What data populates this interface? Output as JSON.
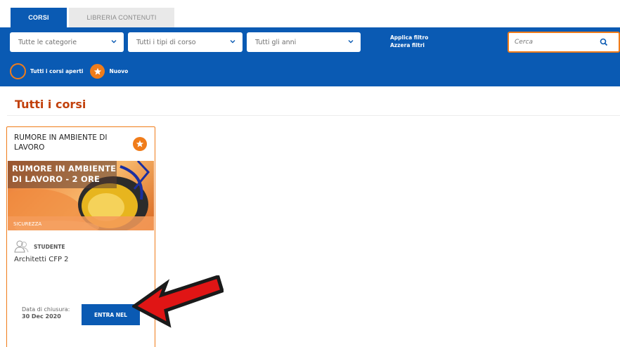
{
  "tabs": [
    {
      "label": "CORSI",
      "active": true
    },
    {
      "label": "LIBRERIA CONTENUTI",
      "active": false
    }
  ],
  "filters": {
    "category": "Tutte le categorie",
    "type": "Tutti i tipi di corso",
    "year": "Tutti gli anni",
    "apply_label": "Applica filtro",
    "reset_label": "Azzera filtri",
    "search_placeholder": "Cerca",
    "search_value": ""
  },
  "legend": {
    "open_courses": "Tutti i corsi aperti",
    "new": "Nuovo"
  },
  "page_title": "Tutti i corsi",
  "course_card": {
    "title": "RUMORE IN AMBIENTE DI LAVORO",
    "image_caption_line1": "RUMORE IN AMBIENTE",
    "image_caption_line2": "DI LAVORO - 2 ORE",
    "category": "SICUREZZA",
    "role": "STUDENTE",
    "course_name": "Architetti CFP 2",
    "close_label": "Data di chiusura:",
    "close_date": "30 Dec  2020",
    "enter_label": "ENTRA NEL",
    "is_new": true
  },
  "icons": {
    "chevron": "chevron-down-icon",
    "search": "search-icon",
    "star": "star-icon",
    "user": "user-outline-icon",
    "arrow": "red-arrow-icon"
  },
  "colors": {
    "primary": "#0a5ab3",
    "accent": "#f07c1a",
    "title": "#c2410c",
    "arrow": "#e01515"
  }
}
